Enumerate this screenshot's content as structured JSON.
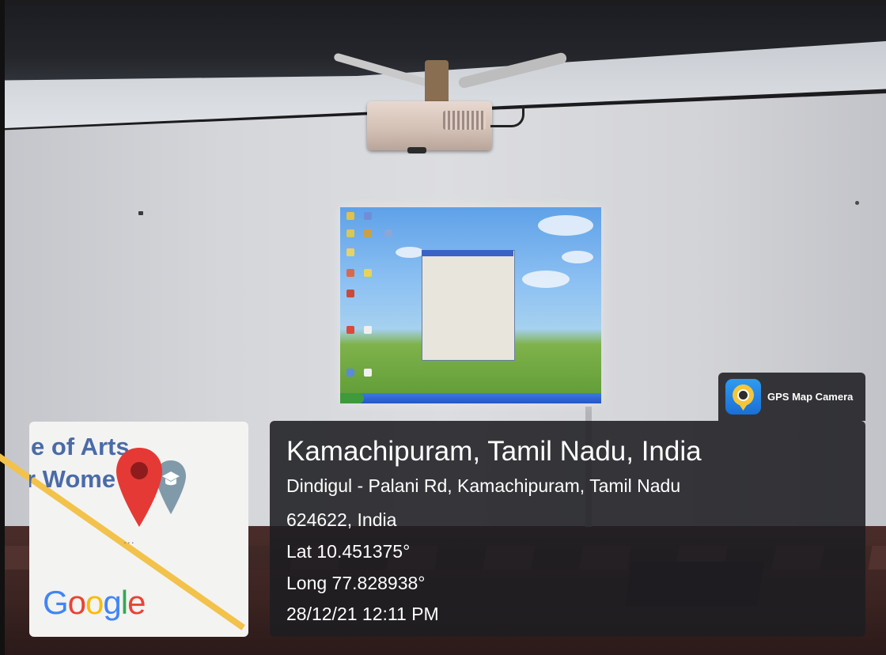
{
  "photo": {
    "description_tag": "classroom-projector-photo"
  },
  "map_tile": {
    "label_line_1": "e of Arts",
    "label_line_2": "r Wome",
    "dots": "...",
    "logo_letters": [
      "G",
      "o",
      "o",
      "g",
      "l",
      "e"
    ],
    "logo_colors": [
      "#4285F4",
      "#EA4335",
      "#FBBC05",
      "#4285F4",
      "#34A853",
      "#EA4335"
    ],
    "pin_color": "#E53935",
    "road_color": "#F2C24A"
  },
  "stamp": {
    "app_icon": "gps-map-camera-icon",
    "app_name": "GPS Map Camera",
    "place": "Kamachipuram, Tamil Nadu, India",
    "address_line_1": "Dindigul - Palani Rd, Kamachipuram, Tamil Nadu",
    "address_line_2": "624622, India",
    "latitude": "Lat 10.451375°",
    "longitude": "Long 77.828938°",
    "datetime": "28/12/21 12:11 PM"
  }
}
